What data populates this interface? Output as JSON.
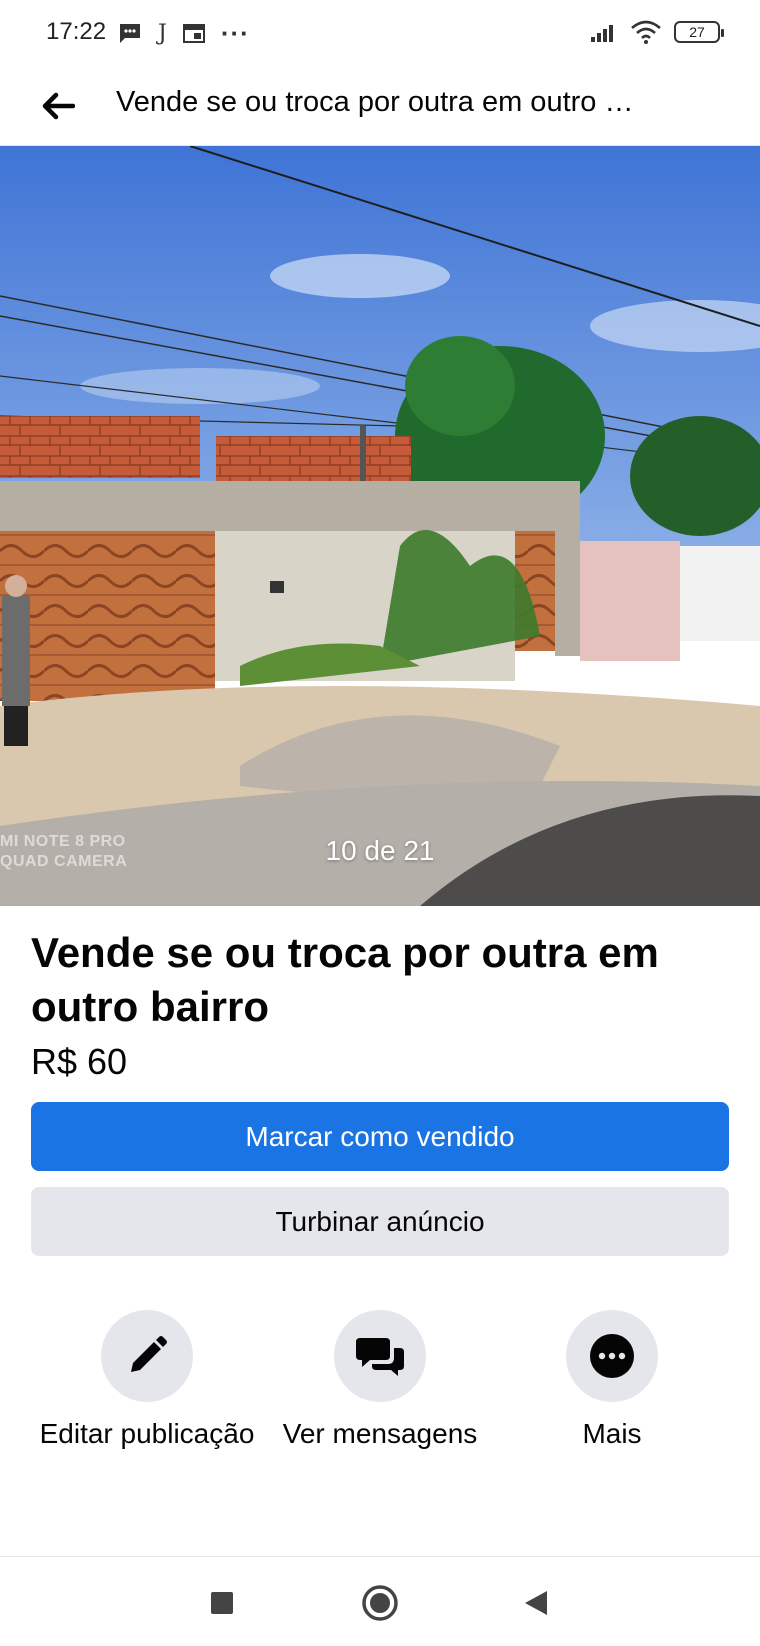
{
  "status_bar": {
    "time": "17:22",
    "left_icons": [
      "message-icon",
      "j-letter-icon",
      "calendar-icon",
      "more-dots-icon"
    ],
    "j_glyph": "J",
    "dots_glyph": "···",
    "battery_level": "27"
  },
  "header": {
    "title": "Vende se ou troca por outra em outro bairro"
  },
  "photo": {
    "counter": "10 de 21",
    "watermark_line1": "MI NOTE 8 PRO",
    "watermark_line2": "QUAD CAMERA"
  },
  "listing": {
    "title": "Vende se ou troca por outra em outro bairro",
    "price": "R$ 60"
  },
  "buttons": {
    "mark_sold": "Marcar como vendido",
    "boost": "Turbinar anúncio"
  },
  "actions": [
    {
      "label": "Editar publicação",
      "icon": "pencil-icon"
    },
    {
      "label": "Ver mensagens",
      "icon": "messages-icon"
    },
    {
      "label": "Mais",
      "icon": "more-icon"
    }
  ],
  "colors": {
    "primary": "#1b74e4",
    "secondary_button": "#e4e6eb",
    "text": "#050505"
  }
}
